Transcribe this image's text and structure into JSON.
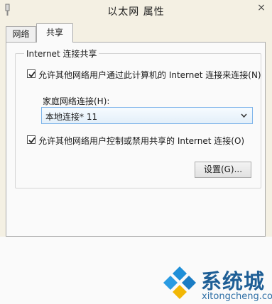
{
  "window": {
    "title": "以太网 属性",
    "close_label": "×"
  },
  "tabs": [
    {
      "label": "网络"
    },
    {
      "label": "共享"
    }
  ],
  "sharing": {
    "group_title": "Internet 连接共享",
    "allow_connect_label": "允许其他网络用户通过此计算机的 Internet 连接来连接(N)",
    "allow_connect_checked": true,
    "home_network_label": "家庭网络连接(H):",
    "home_network_value": "本地连接* 11",
    "allow_control_label": "允许其他网络用户控制或禁用共享的 Internet 连接(O)",
    "allow_control_checked": true,
    "settings_button": "设置(G)..."
  },
  "watermark": {
    "name": "系统城",
    "url": "xitongcheng.com",
    "colors": {
      "blue": "#1f8fd8",
      "dark": "#1f5f96"
    }
  }
}
